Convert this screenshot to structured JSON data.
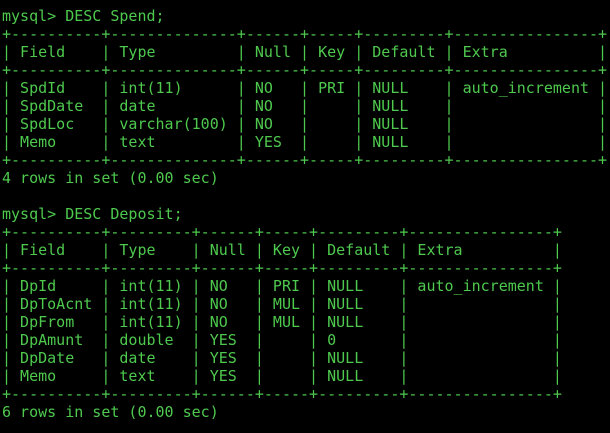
{
  "terminal": {
    "colors": {
      "background": "#000000",
      "foreground": "#4ec94e"
    },
    "lines": [
      "mysql> DESC Spend;",
      "+----------+--------------+------+-----+---------+----------------+",
      "| Field    | Type         | Null | Key | Default | Extra          |",
      "+----------+--------------+------+-----+---------+----------------+",
      "| SpdId    | int(11)      | NO   | PRI | NULL    | auto_increment |",
      "| SpdDate  | date         | NO   |     | NULL    |                |",
      "| SpdLoc   | varchar(100) | NO   |     | NULL    |                |",
      "| Memo     | text         | YES  |     | NULL    |                |",
      "+----------+--------------+------+-----+---------+----------------+",
      "4 rows in set (0.00 sec)",
      "",
      "mysql> DESC Deposit;",
      "+----------+---------+------+-----+---------+----------------+",
      "| Field    | Type    | Null | Key | Default | Extra          |",
      "+----------+---------+------+-----+---------+----------------+",
      "| DpId     | int(11) | NO   | PRI | NULL    | auto_increment |",
      "| DpToAcnt | int(11) | NO   | MUL | NULL    |                |",
      "| DpFrom   | int(11) | NO   | MUL | NULL    |                |",
      "| DpAmunt  | double  | YES  |     | 0       |                |",
      "| DpDate   | date    | YES  |     | NULL    |                |",
      "| Memo     | text    | YES  |     | NULL    |                |",
      "+----------+---------+------+-----+---------+----------------+",
      "6 rows in set (0.00 sec)"
    ]
  }
}
